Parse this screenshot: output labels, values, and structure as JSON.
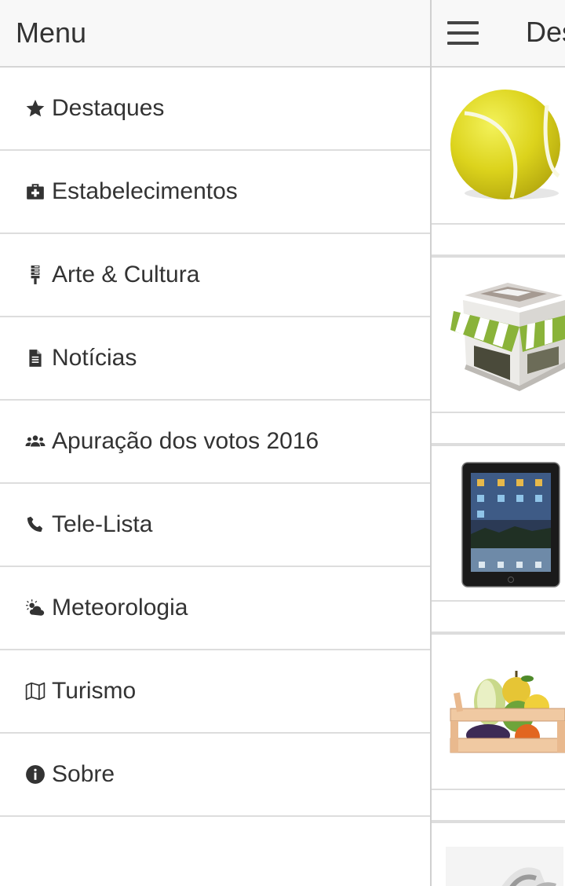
{
  "menu": {
    "title": "Menu",
    "items": [
      {
        "label": "Destaques",
        "icon": "star-icon"
      },
      {
        "label": "Estabelecimentos",
        "icon": "medkit-icon"
      },
      {
        "label": "Arte & Cultura",
        "icon": "microphone-icon"
      },
      {
        "label": "Notícias",
        "icon": "document-icon"
      },
      {
        "label": "Apuração dos votos 2016",
        "icon": "users-icon"
      },
      {
        "label": "Tele-Lista",
        "icon": "phone-icon"
      },
      {
        "label": "Meteorologia",
        "icon": "weather-icon"
      },
      {
        "label": "Turismo",
        "icon": "map-icon"
      },
      {
        "label": "Sobre",
        "icon": "info-icon"
      }
    ]
  },
  "main": {
    "title": "Destaques",
    "menu_icon": "hamburger-icon",
    "cards": [
      {
        "image": "tennis-ball-image"
      },
      {
        "image": "shop-image"
      },
      {
        "image": "tablet-image"
      },
      {
        "image": "fruit-crate-image"
      },
      {
        "image": "partial-image"
      }
    ]
  },
  "colors": {
    "header_bg": "#f8f8f8",
    "text": "#333333",
    "divider": "#dddddd"
  }
}
